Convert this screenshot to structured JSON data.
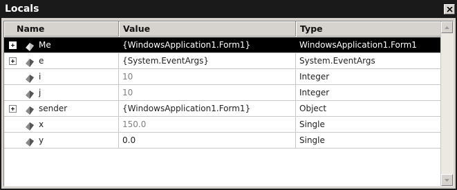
{
  "window": {
    "title": "Locals"
  },
  "columns": {
    "name": "Name",
    "value": "Value",
    "type": "Type"
  },
  "rows": [
    {
      "name": "Me",
      "value": "{WindowsApplication1.Form1}",
      "type": "WindowsApplication1.Form1",
      "expandable": true,
      "selected": true,
      "value_muted": false
    },
    {
      "name": "e",
      "value": "{System.EventArgs}",
      "type": "System.EventArgs",
      "expandable": true,
      "selected": false,
      "value_muted": false
    },
    {
      "name": "i",
      "value": "10",
      "type": "Integer",
      "expandable": false,
      "selected": false,
      "value_muted": true
    },
    {
      "name": "j",
      "value": "10",
      "type": "Integer",
      "expandable": false,
      "selected": false,
      "value_muted": true
    },
    {
      "name": "sender",
      "value": "{WindowsApplication1.Form1}",
      "type": "Object",
      "expandable": true,
      "selected": false,
      "value_muted": false
    },
    {
      "name": "x",
      "value": "150.0",
      "type": "Single",
      "expandable": false,
      "selected": false,
      "value_muted": true
    },
    {
      "name": "y",
      "value": "0.0",
      "type": "Single",
      "expandable": false,
      "selected": false,
      "value_muted": false
    }
  ],
  "icons": {
    "close": "close-icon",
    "expand": "plus-expander-icon",
    "field": "field-diamond-icon",
    "scroll_up": "arrow-up-icon",
    "scroll_down": "arrow-down-icon"
  },
  "colors": {
    "selection": "#000000",
    "title_bar": "#1a1a1a",
    "muted_value": "#808080"
  }
}
